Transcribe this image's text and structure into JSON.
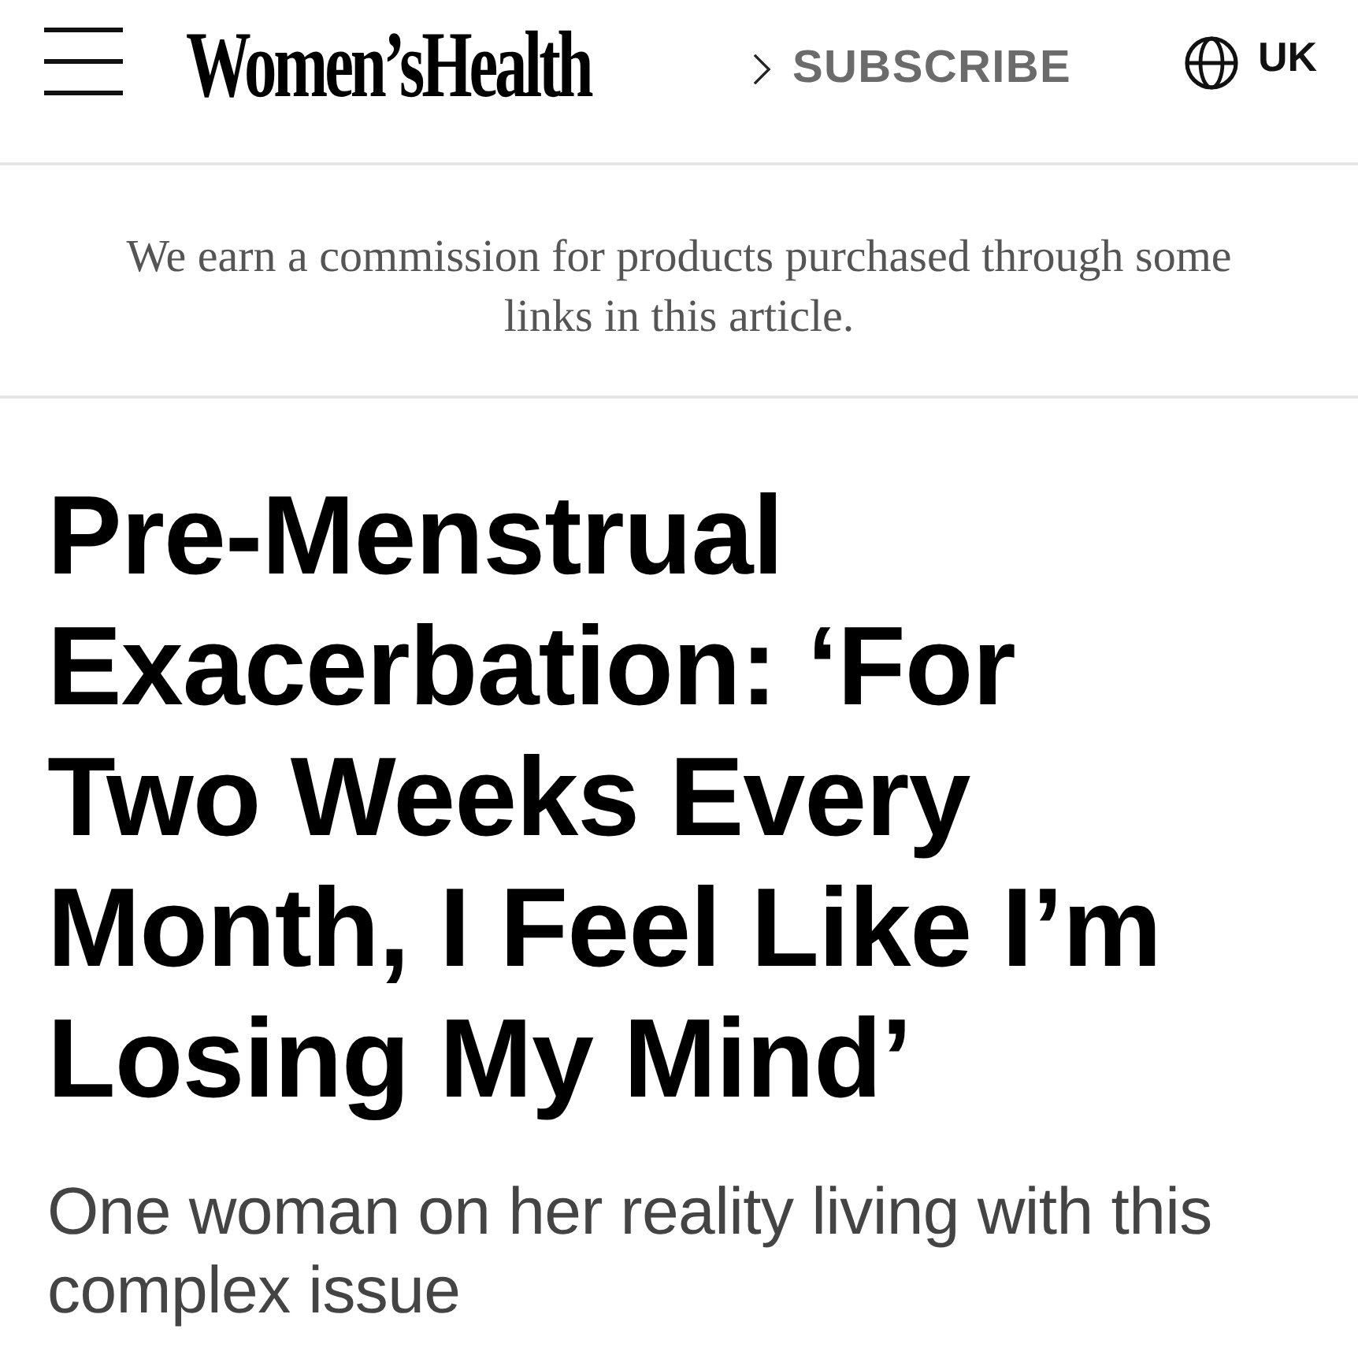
{
  "header": {
    "logo": "Women’sHealth",
    "subscribe": {
      "label": "SUBSCRIBE"
    },
    "region": {
      "label": "UK"
    }
  },
  "disclaimer": "We earn a commission for products purchased through some links in this article.",
  "article": {
    "headline": "Pre-Menstrual Exacerbation: ‘For Two Weeks Every Month, I Feel Like I’m Losing My Mind’",
    "dek": "One woman on her reality living with this complex issue"
  }
}
